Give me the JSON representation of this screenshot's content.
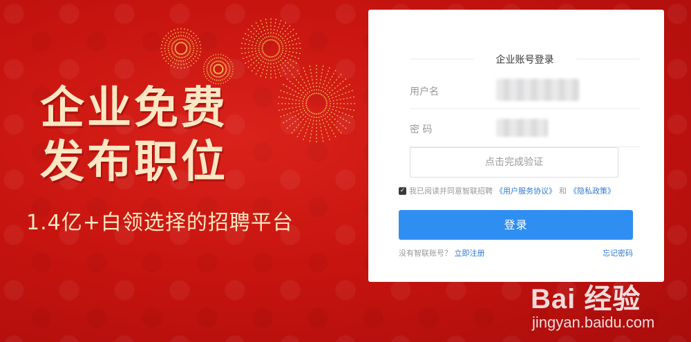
{
  "hero": {
    "title_line1": "企业免费",
    "title_line2": "发布职位",
    "subtitle": "1.4亿+白领选择的招聘平台"
  },
  "login": {
    "title": "企业账号登录",
    "username_label": "用户名",
    "password_label": "密 码",
    "username_value": "",
    "password_value": "",
    "captcha_label": "点击完成验证",
    "agree_text": "我已阅读并同意智联招聘",
    "agree_link_1": "《用户服务协议》",
    "agree_and": "和",
    "agree_link_2": "《隐私政策》",
    "agree_checked": true,
    "submit_label": "登录",
    "no_account_text": "没有智联账号？",
    "register_link": "立即注册",
    "forgot_link": "忘记密码"
  },
  "watermark": {
    "logo_text": "Bai 经验",
    "url": "jingyan.baidu.com"
  },
  "colors": {
    "background_red": "#c8140f",
    "hero_text": "#fbe7c3",
    "button_blue": "#2f8ef2",
    "link_blue": "#2f7ad6"
  }
}
